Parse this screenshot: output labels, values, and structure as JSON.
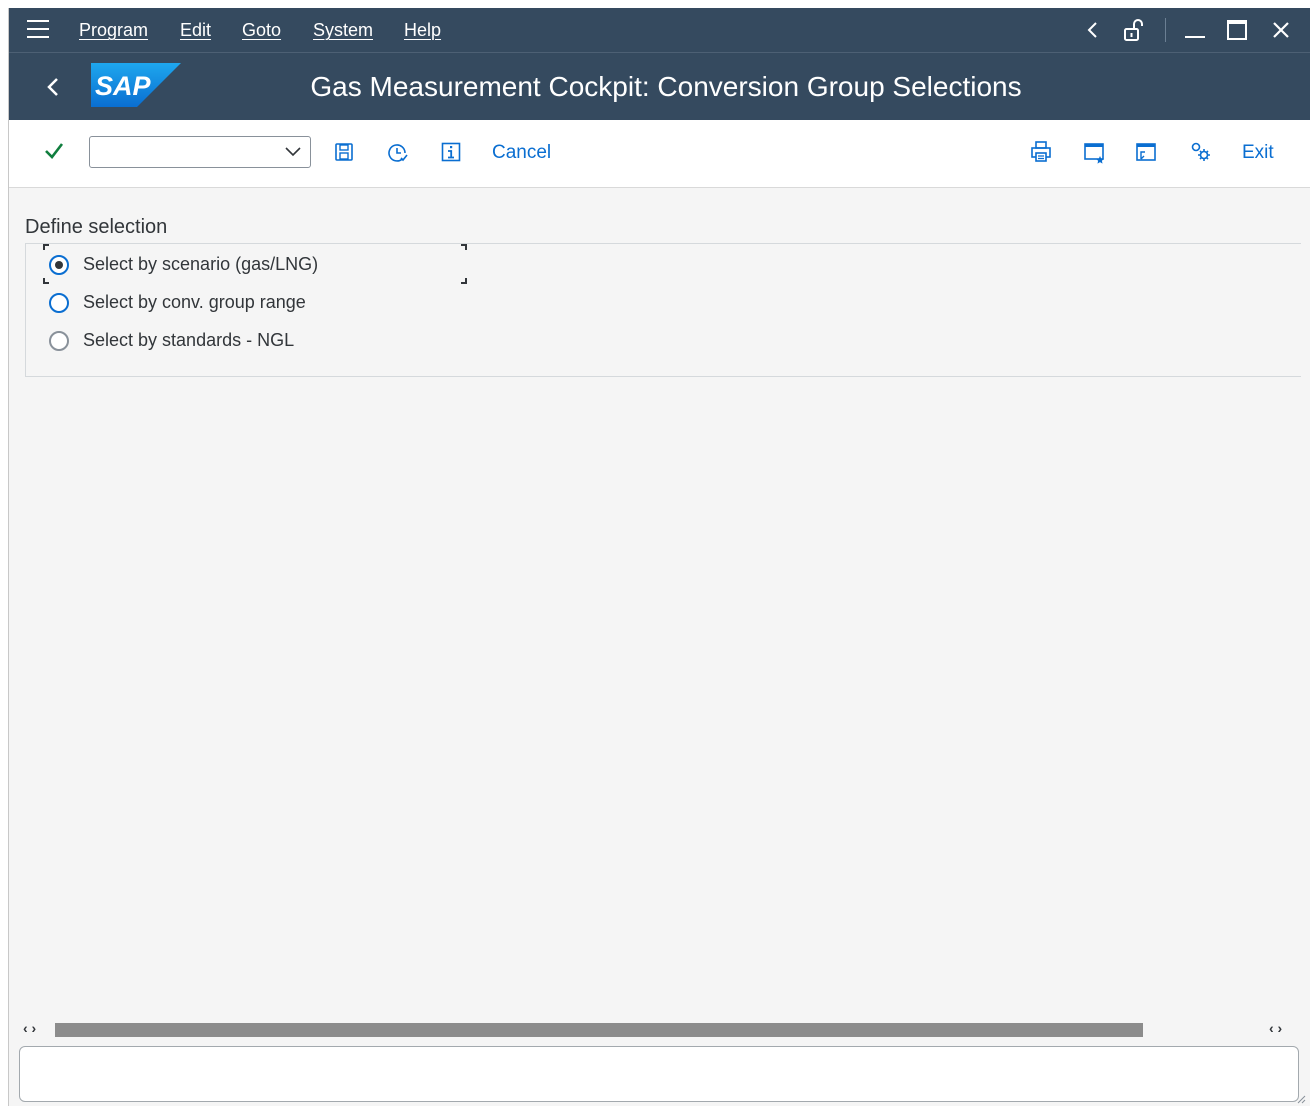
{
  "menubar": {
    "items": [
      "Program",
      "Edit",
      "Goto",
      "System",
      "Help"
    ],
    "menu_icon": "hamburger-menu-icon"
  },
  "titlebar": {
    "logo_text": "SAP",
    "title": "Gas Measurement Cockpit: Conversion Group Selections"
  },
  "toolbar": {
    "command_field_value": "",
    "cancel_label": "Cancel",
    "exit_label": "Exit",
    "icons": [
      "enter-check-icon",
      "save-icon",
      "execute-history-icon",
      "info-icon",
      "print-icon",
      "create-session-icon",
      "generate-shortcut-icon",
      "customize-layout-icon"
    ]
  },
  "selection": {
    "section_title": "Define selection",
    "options": [
      {
        "label": "Select by scenario (gas/LNG)",
        "selected": true
      },
      {
        "label": "Select by conv. group range",
        "selected": false
      },
      {
        "label": "Select by standards - NGL",
        "selected": false
      }
    ]
  },
  "statusbar": {
    "text": ""
  },
  "colors": {
    "shell_header": "#354a5f",
    "accent": "#0a6ed1",
    "check_green": "#107e3e",
    "background": "#f5f5f5"
  }
}
